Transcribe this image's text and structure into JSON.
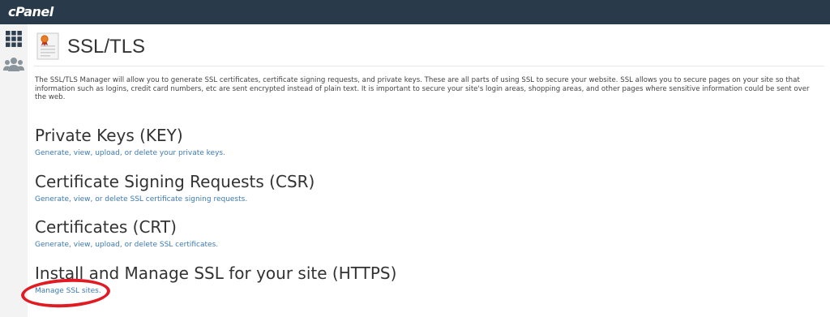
{
  "app": {
    "brand": "cPanel"
  },
  "page": {
    "title": "SSL/TLS",
    "intro": "The SSL/TLS Manager will allow you to generate SSL certificates, certificate signing requests, and private keys. These are all parts of using SSL to secure your website. SSL allows you to secure pages on your site so that information such as logins, credit card numbers, etc are sent encrypted instead of plain text. It is important to secure your site's login areas, shopping areas, and other pages where sensitive information could be sent over the web."
  },
  "sections": [
    {
      "heading": "Private Keys (KEY)",
      "link": "Generate, view, upload, or delete your private keys."
    },
    {
      "heading": "Certificate Signing Requests (CSR)",
      "link": "Generate, view, or delete SSL certificate signing requests."
    },
    {
      "heading": "Certificates (CRT)",
      "link": "Generate, view, upload, or delete SSL certificates."
    },
    {
      "heading": "Install and Manage SSL for your site (HTTPS)",
      "link": "Manage SSL sites."
    }
  ],
  "colors": {
    "topbar": "#293a4a",
    "link": "#3c79b5",
    "annotation": "#e01b24"
  },
  "icons": {
    "nav_home": "grid-icon",
    "nav_users": "users-icon",
    "page": "certificate-icon"
  }
}
